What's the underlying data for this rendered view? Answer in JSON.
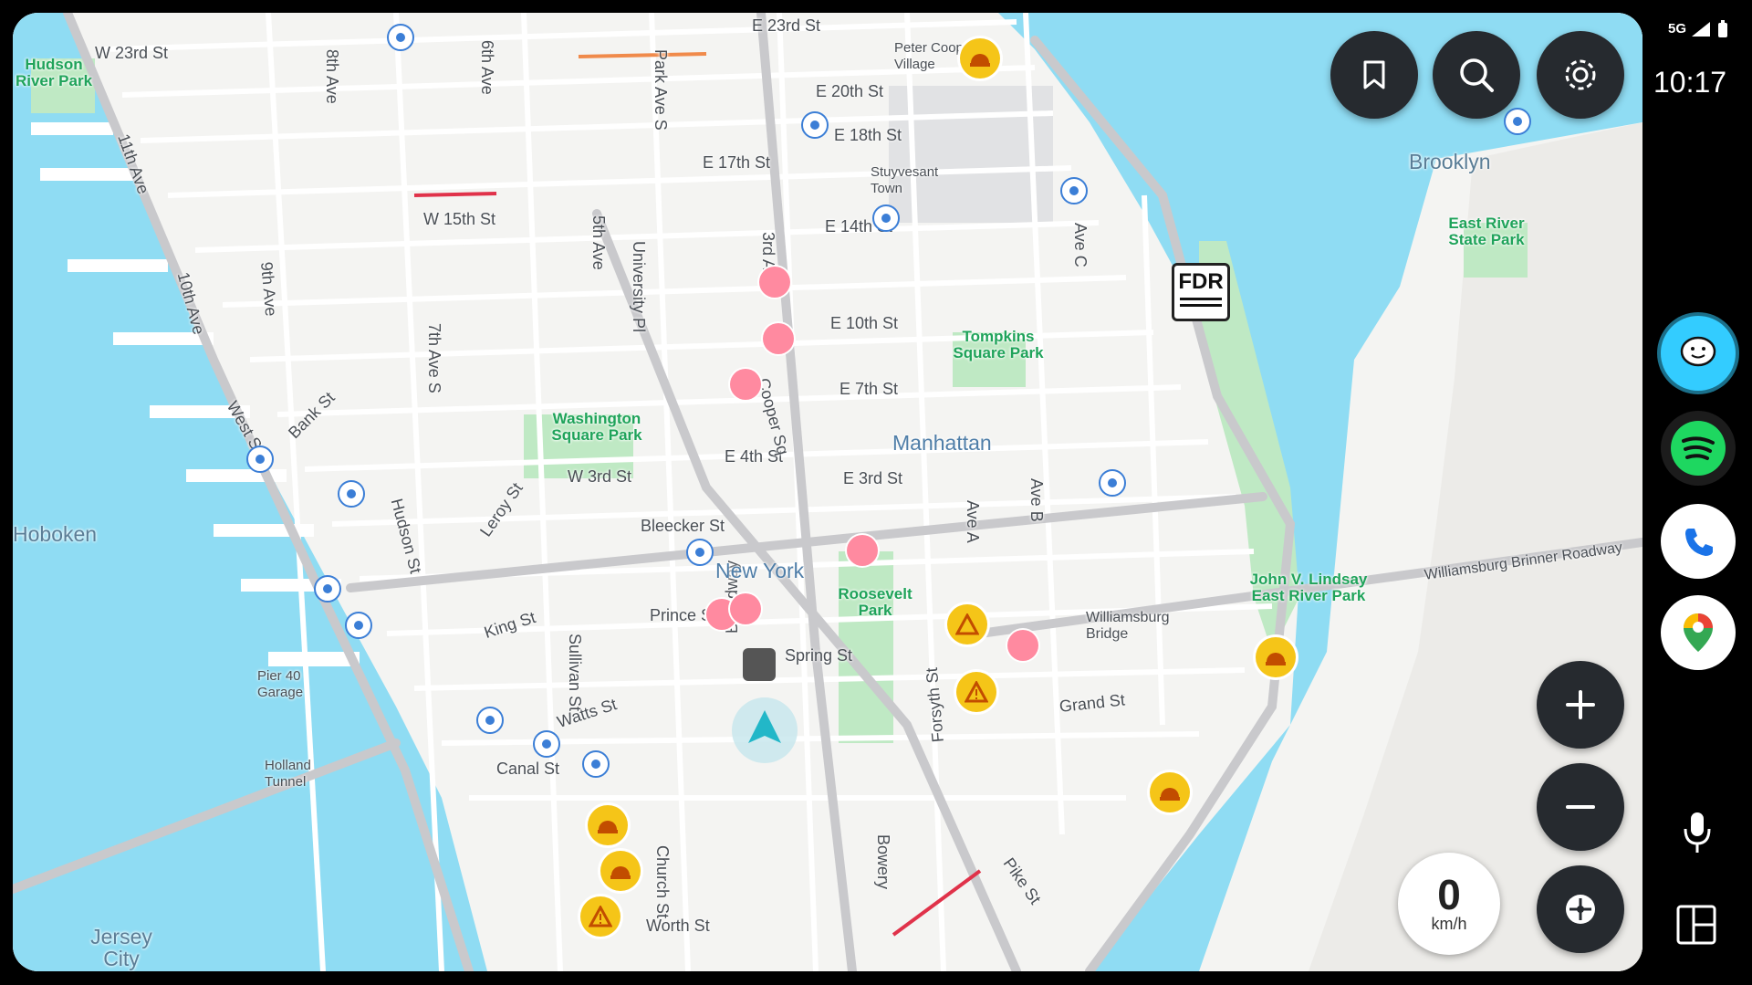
{
  "status_bar": {
    "network": "5G",
    "time": "10:17"
  },
  "map_labels": {
    "streets": [
      "W 23rd St",
      "E 23rd St",
      "E 20th St",
      "E 18th St",
      "E 17th St",
      "E 14th St",
      "W 15th St",
      "E 10th St",
      "E 7th St",
      "E 4th St",
      "E 3rd St",
      "W 3rd St",
      "Bleecker St",
      "Prince St",
      "Spring St",
      "King St",
      "Watts St",
      "Canal St",
      "Grand St",
      "Worth St",
      "Park Ave S",
      "5th Ave",
      "University Pl",
      "3rd Ave",
      "Cooper Sq",
      "Ave C",
      "Ave A",
      "Ave B",
      "8th Ave",
      "7th Ave S",
      "9th Ave",
      "10th Ave",
      "11th Ave",
      "6th Ave",
      "Bank St",
      "Hudson St",
      "Leroy St",
      "West St",
      "Sullivan St",
      "Broadway",
      "Church St",
      "Forsyth St",
      "Bowery",
      "Pike St",
      "Williamsburg Bridge",
      "Williamsburg Brinner Roadway"
    ],
    "areas": [
      "Manhattan",
      "New York",
      "Brooklyn",
      "Hoboken",
      "Jersey City",
      "Stuyvesant Town",
      "Peter Cooper Village"
    ],
    "parks": [
      "Washington Square Park",
      "Tompkins Square Park",
      "Roosevelt Park",
      "John V. Lindsay East River Park",
      "East River State Park",
      "Hudson River Park"
    ],
    "landmarks": [
      "Pier 40 Garage",
      "Holland Tunnel"
    ],
    "highway_shield": "FDR"
  },
  "speedometer": {
    "value": "0",
    "unit": "km/h"
  },
  "buttons": {
    "saved": "bookmark-icon",
    "search": "search-icon",
    "settings": "gear-icon",
    "zoom_in": "plus-icon",
    "zoom_out": "minus-icon",
    "recenter": "recenter-icon"
  },
  "rail_apps": [
    "waze",
    "spotify",
    "phone",
    "google-maps"
  ],
  "colors": {
    "water": "#8fdcf3",
    "park": "#bfe9c4",
    "land": "#f4f4f2",
    "button": "#262a2f",
    "hazard": "#f5c518",
    "nav_arrow": "#22b7c8"
  }
}
